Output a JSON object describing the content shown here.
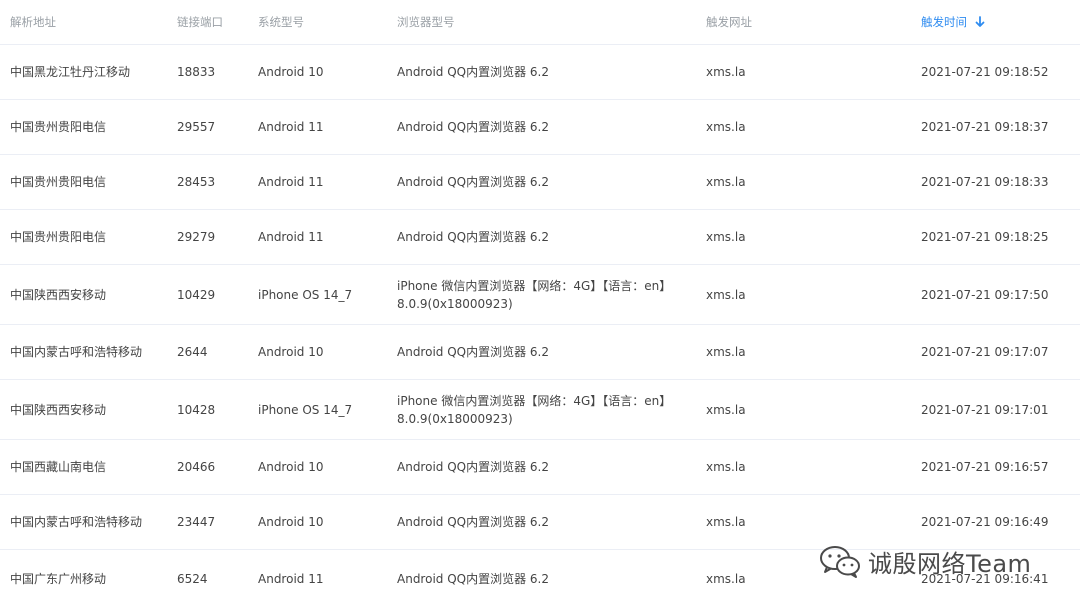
{
  "header": {
    "columns": [
      "解析地址",
      "链接端口",
      "系统型号",
      "浏览器型号",
      "触发网址",
      "触发时间"
    ],
    "sorted_column_color": "#2f8cf0",
    "sort_icon": "arrow-down-icon"
  },
  "rows": [
    {
      "address": "中国黑龙江牡丹江移动",
      "port": "18833",
      "os": "Android 10",
      "browser": "Android QQ内置浏览器 6.2",
      "url": "xms.la",
      "time": "2021-07-21 09:18:52"
    },
    {
      "address": "中国贵州贵阳电信",
      "port": "29557",
      "os": "Android 11",
      "browser": "Android QQ内置浏览器 6.2",
      "url": "xms.la",
      "time": "2021-07-21 09:18:37"
    },
    {
      "address": "中国贵州贵阳电信",
      "port": "28453",
      "os": "Android 11",
      "browser": "Android QQ内置浏览器 6.2",
      "url": "xms.la",
      "time": "2021-07-21 09:18:33"
    },
    {
      "address": "中国贵州贵阳电信",
      "port": "29279",
      "os": "Android 11",
      "browser": "Android QQ内置浏览器 6.2",
      "url": "xms.la",
      "time": "2021-07-21 09:18:25"
    },
    {
      "address": "中国陕西西安移动",
      "port": "10429",
      "os": "iPhone OS 14_7",
      "browser": "iPhone 微信内置浏览器【网络：4G】【语言：en】8.0.9(0x18000923)",
      "url": "xms.la",
      "time": "2021-07-21 09:17:50"
    },
    {
      "address": "中国内蒙古呼和浩特移动",
      "port": "2644",
      "os": "Android 10",
      "browser": "Android QQ内置浏览器 6.2",
      "url": "xms.la",
      "time": "2021-07-21 09:17:07"
    },
    {
      "address": "中国陕西西安移动",
      "port": "10428",
      "os": "iPhone OS 14_7",
      "browser": "iPhone 微信内置浏览器【网络：4G】【语言：en】8.0.9(0x18000923)",
      "url": "xms.la",
      "time": "2021-07-21 09:17:01"
    },
    {
      "address": "中国西藏山南电信",
      "port": "20466",
      "os": "Android 10",
      "browser": "Android QQ内置浏览器 6.2",
      "url": "xms.la",
      "time": "2021-07-21 09:16:57"
    },
    {
      "address": "中国内蒙古呼和浩特移动",
      "port": "23447",
      "os": "Android 10",
      "browser": "Android QQ内置浏览器 6.2",
      "url": "xms.la",
      "time": "2021-07-21 09:16:49"
    },
    {
      "address": "中国广东广州移动",
      "port": "6524",
      "os": "Android 11",
      "browser": "Android QQ内置浏览器 6.2",
      "url": "xms.la",
      "time": "2021-07-21 09:16:41"
    }
  ],
  "watermark": {
    "text": "诚殷网络Team",
    "icon": "wechat-icon"
  }
}
